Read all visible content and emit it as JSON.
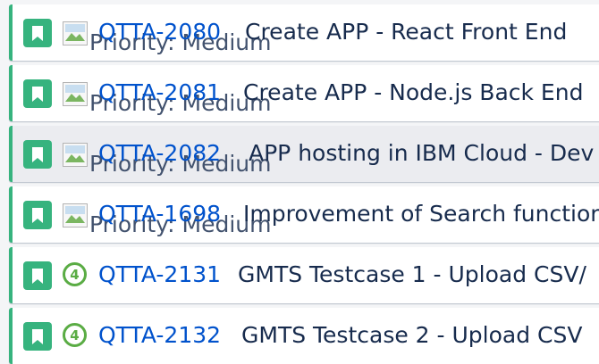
{
  "accent_color": "#36b37e",
  "link_color": "#0052cc",
  "issues": [
    {
      "type_icon": "story-bookmark-icon",
      "priority_alt": "Priority: Medium",
      "key": "QTTA-2080",
      "summary": "Create APP - React Front End"
    },
    {
      "type_icon": "story-bookmark-icon",
      "priority_alt": "Priority: Medium",
      "key": "QTTA-2081",
      "summary": "Create APP - Node.js Back End"
    },
    {
      "type_icon": "story-bookmark-icon",
      "priority_alt": "Priority: Medium",
      "key": "QTTA-2082",
      "summary": "APP hosting in IBM Cloud - Dev"
    },
    {
      "type_icon": "story-bookmark-icon",
      "priority_alt": "Priority: Medium",
      "key": "QTTA-1698",
      "summary": "Improvement of Search function"
    },
    {
      "type_icon": "story-bookmark-icon",
      "story_points": "4",
      "key": "QTTA-2131",
      "summary": "GMTS Testcase 1 - Upload CSV/"
    },
    {
      "type_icon": "story-bookmark-icon",
      "story_points": "4",
      "key": "QTTA-2132",
      "summary": "GMTS Testcase 2 - Upload CSV"
    }
  ]
}
